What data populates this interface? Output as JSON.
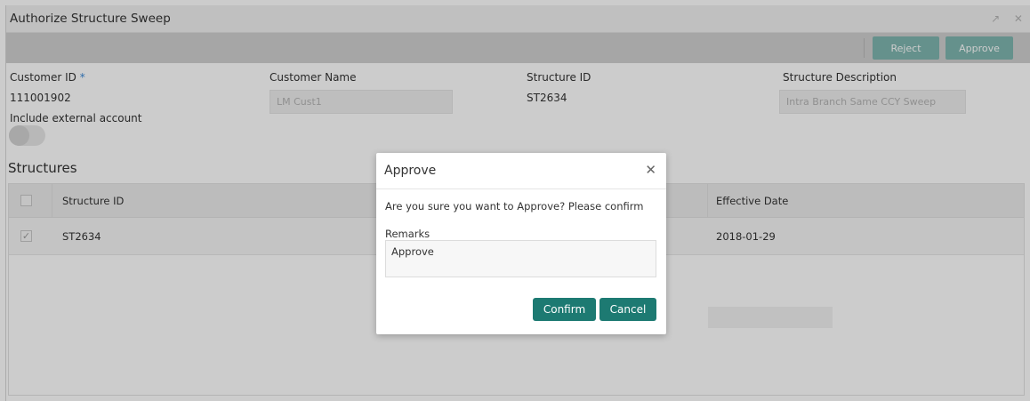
{
  "window": {
    "title": "Authorize Structure Sweep",
    "controls": "↗ ✕"
  },
  "toolbar": {
    "reject_label": "Reject",
    "approve_label": "Approve"
  },
  "form": {
    "customer_id": {
      "label": "Customer ID",
      "required_mark": "*",
      "value": "111001902"
    },
    "customer_name": {
      "label": "Customer Name",
      "value": "LM Cust1"
    },
    "structure_id": {
      "label": "Structure ID",
      "value": "ST2634"
    },
    "structure_description": {
      "label": "Structure Description",
      "value": "Intra Branch Same CCY Sweep"
    },
    "include_external": {
      "label": "Include external account",
      "state": "off"
    }
  },
  "structures": {
    "title": "Structures",
    "columns": [
      "",
      "Structure ID",
      "Effective Date"
    ],
    "rows": [
      {
        "checked": true,
        "check_glyph": "✓",
        "structure_id": "ST2634",
        "effective_date": "2018-01-29"
      }
    ]
  },
  "dialog": {
    "title": "Approve",
    "close_glyph": "✕",
    "message": "Are you sure you want to Approve? Please confirm",
    "remarks_label": "Remarks",
    "remarks_value": "Approve",
    "confirm_label": "Confirm",
    "cancel_label": "Cancel"
  },
  "colors": {
    "accent": "#1d7a72",
    "toolbar_button": "#7fb6b0",
    "required": "#3a87d6"
  }
}
